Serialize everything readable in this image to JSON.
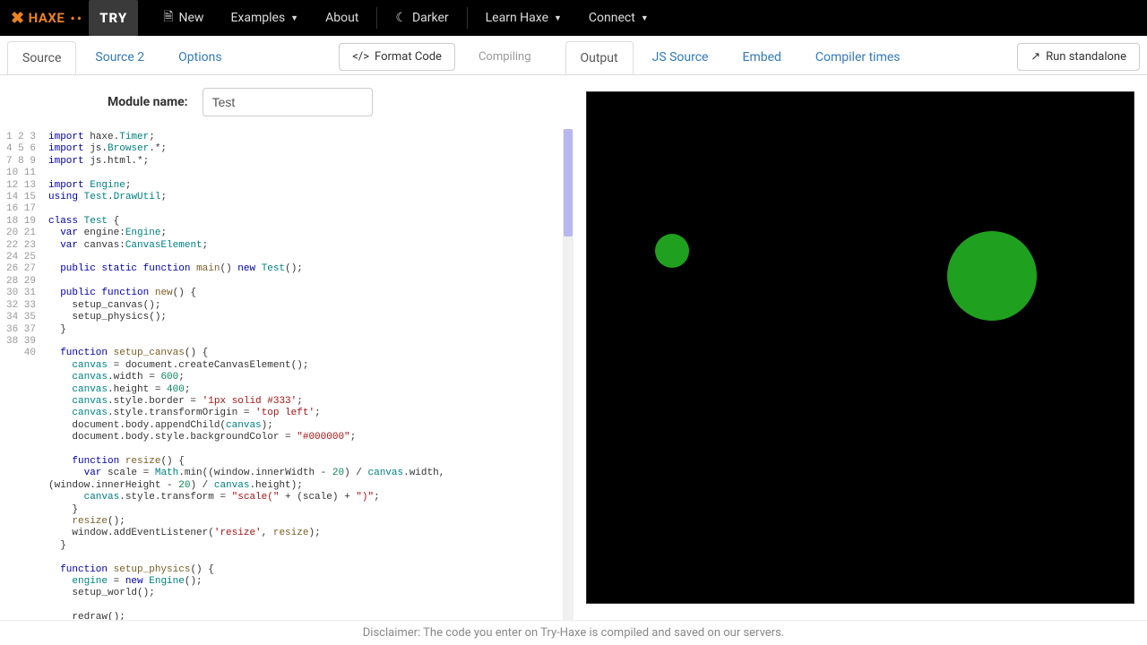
{
  "logo": {
    "haxe": "HAXE",
    "try": "TRY"
  },
  "nav": {
    "new": "New",
    "examples": "Examples",
    "about": "About",
    "darker": "Darker",
    "learn": "Learn Haxe",
    "connect": "Connect"
  },
  "leftTabs": {
    "source": "Source",
    "source2": "Source 2",
    "options": "Options"
  },
  "centerBtns": {
    "format": "Format Code",
    "compiling": "Compiling"
  },
  "rightTabs": {
    "output": "Output",
    "js": "JS Source",
    "embed": "Embed",
    "times": "Compiler times"
  },
  "runBtn": "Run standalone",
  "module": {
    "label": "Module name:",
    "value": "Test"
  },
  "lines": [
    "1",
    "2",
    "3",
    "4",
    "5",
    "6",
    "7",
    "8",
    "9",
    "10",
    "11",
    "12",
    "13",
    "14",
    "15",
    "16",
    "17",
    "18",
    "19",
    "20",
    "21",
    "22",
    "23",
    "24",
    "25",
    "26",
    "27",
    "28",
    "29",
    "30",
    "31",
    "32",
    "33",
    "34",
    "35",
    "36",
    "37",
    "38",
    "39",
    "40"
  ],
  "code": {
    "l1a": "import",
    "l1b": " haxe.",
    "l1c": "Timer",
    "l1d": ";",
    "l2a": "import",
    "l2b": " js.",
    "l2c": "Browser",
    "l2d": ".*;",
    "l3a": "import",
    "l3b": " js.html.*;",
    "l5a": "import",
    "l5b": " ",
    "l5c": "Engine",
    "l5d": ";",
    "l6a": "using",
    "l6b": " ",
    "l6c": "Test",
    "l6d": ".",
    "l6e": "DrawUtil",
    "l6f": ";",
    "l8a": "class",
    "l8b": " ",
    "l8c": "Test",
    "l8d": " {",
    "l9a": "  var",
    "l9b": " engine:",
    "l9c": "Engine",
    "l9d": ";",
    "l10a": "  var",
    "l10b": " canvas:",
    "l10c": "CanvasElement",
    "l10d": ";",
    "l12a": "  public",
    "l12b": " ",
    "l12c": "static",
    "l12d": " ",
    "l12e": "function",
    "l12f": " ",
    "l12g": "main",
    "l12h": "() ",
    "l12i": "new",
    "l12j": " ",
    "l12k": "Test",
    "l12l": "();",
    "l14a": "  public",
    "l14b": " ",
    "l14c": "function",
    "l14d": " ",
    "l14e": "new",
    "l14f": "() {",
    "l15": "    setup_canvas();",
    "l16": "    setup_physics();",
    "l17": "  }",
    "l19a": "  function",
    "l19b": " ",
    "l19c": "setup_canvas",
    "l19d": "() {",
    "l20a": "    ",
    "l20b": "canvas",
    "l20c": " = document.createCanvasElement();",
    "l21a": "    ",
    "l21b": "canvas",
    "l21c": ".width = ",
    "l21d": "600",
    "l21e": ";",
    "l22a": "    ",
    "l22b": "canvas",
    "l22c": ".height = ",
    "l22d": "400",
    "l22e": ";",
    "l23a": "    ",
    "l23b": "canvas",
    "l23c": ".style.border = ",
    "l23d": "'1px solid #333'",
    "l23e": ";",
    "l24a": "    ",
    "l24b": "canvas",
    "l24c": ".style.transformOrigin = ",
    "l24d": "'top left'",
    "l24e": ";",
    "l25a": "    document.body.appendChild(",
    "l25b": "canvas",
    "l25c": ");",
    "l26a": "    document.body.style.backgroundColor = ",
    "l26b": "\"#000000\"",
    "l26c": ";",
    "l28a": "    function",
    "l28b": " ",
    "l28c": "resize",
    "l28d": "() {",
    "l29a": "      var",
    "l29b": " scale = ",
    "l29c": "Math",
    "l29d": ".min((window.innerWidth - ",
    "l29e": "20",
    "l29f": ") / ",
    "l29g": "canvas",
    "l29h": ".width,",
    "l29x": "(window.innerHeight - ",
    "l29y": "20",
    "l29z": ") / ",
    "l29w": "canvas",
    "l29v": ".height);",
    "l30a": "      ",
    "l30b": "canvas",
    "l30c": ".style.transform = ",
    "l30d": "\"scale(\"",
    "l30e": " + (scale) + ",
    "l30f": "\")\"",
    "l30g": ";",
    "l31": "    }",
    "l32a": "    ",
    "l32b": "resize",
    "l32c": "();",
    "l33a": "    window.addEventListener(",
    "l33b": "'resize'",
    "l33c": ", ",
    "l33d": "resize",
    "l33e": ");",
    "l34": "  }",
    "l36a": "  function",
    "l36b": " ",
    "l36c": "setup_physics",
    "l36d": "() {",
    "l37a": "    ",
    "l37b": "engine",
    "l37c": " = ",
    "l37d": "new",
    "l37e": " ",
    "l37f": "Engine",
    "l37g": "();",
    "l38": "    setup_world();",
    "l40": "    redraw();"
  },
  "footer": "Disclaimer: The code you enter on Try-Haxe is compiled and saved on our servers."
}
